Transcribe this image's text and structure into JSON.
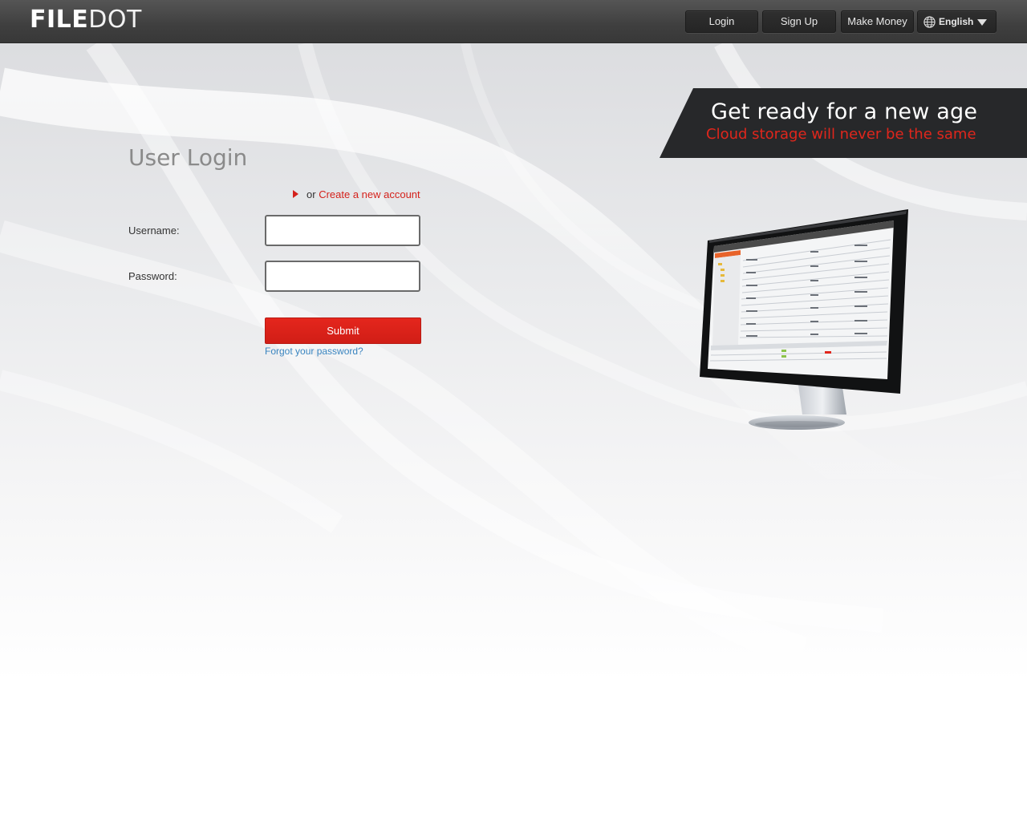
{
  "header": {
    "logo_bold": "FILE",
    "logo_thin": "DOT",
    "nav": {
      "login": "Login",
      "signup": "Sign Up",
      "make_money": "Make Money",
      "language": "English"
    }
  },
  "banner": {
    "title": "Get ready for a new age",
    "subtitle": "Cloud storage will never be the same"
  },
  "login": {
    "title": "User Login",
    "or_text": "or",
    "create_account": "Create a new account",
    "username_label": "Username:",
    "username_value": "",
    "password_label": "Password:",
    "password_value": "",
    "submit": "Submit",
    "forgot": "Forgot your password?"
  },
  "colors": {
    "accent_red": "#d4211b",
    "header_bg": "#3f3f3f",
    "banner_bg": "#27282a",
    "link_blue": "#3a85c0"
  }
}
